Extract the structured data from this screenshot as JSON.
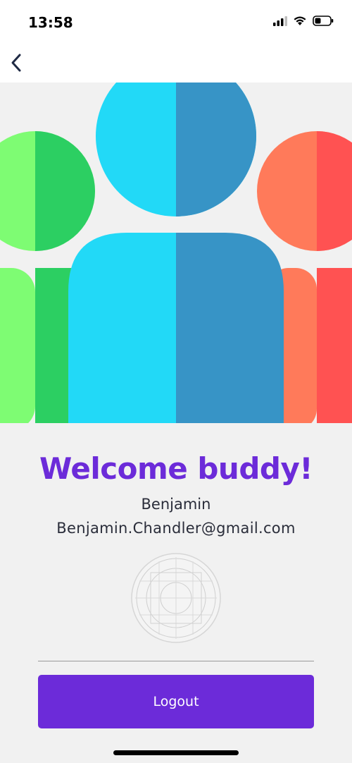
{
  "status_bar": {
    "time": "13:58",
    "icons": [
      "cellular-signal-icon",
      "wifi-icon",
      "battery-icon"
    ]
  },
  "nav": {
    "back_icon": "chevron-left-icon"
  },
  "hero": {
    "illustration": "group-of-people-illustration",
    "colors": {
      "green_light": "#7efc73",
      "green_dark": "#2ccf62",
      "cyan_light": "#22d9f7",
      "blue_dark": "#3794c6",
      "orange_light": "#ff7a5a",
      "red_dark": "#ff5252"
    }
  },
  "profile": {
    "welcome_title": "Welcome buddy!",
    "name": "Benjamin",
    "email": "Benjamin.Chandler@gmail.com",
    "avatar_icon": "avatar-placeholder-icon"
  },
  "actions": {
    "logout_label": "Logout"
  },
  "theme": {
    "accent": "#6c2bd9",
    "background": "#f1f1f1"
  }
}
